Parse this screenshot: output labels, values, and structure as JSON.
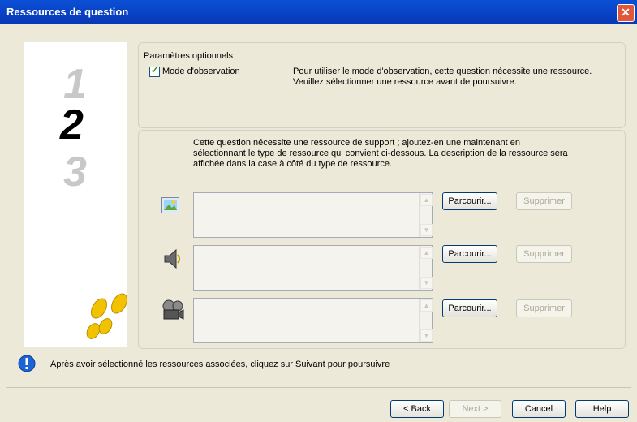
{
  "window": {
    "title": "Ressources de question",
    "close_glyph": "✕"
  },
  "steps": {
    "one": "1",
    "two": "2",
    "three": "3"
  },
  "optional": {
    "legend": "Paramètres optionnels",
    "observation_label": "Mode d'observation",
    "observation_checked": true,
    "observation_text": "Pour utiliser le mode d'observation, cette question nécessite une ressource. Veuillez sélectionner une ressource avant de poursuivre."
  },
  "resources": {
    "instructions": "Cette question nécessite une ressource de support ; ajoutez-en une maintenant en sélectionnant le type de ressource qui convient ci-dessous. La description de la ressource sera affichée dans la case à côté du type de ressource.",
    "rows": [
      {
        "type_icon": "image-icon",
        "description": "",
        "browse_label": "Parcourir...",
        "delete_label": "Supprimer"
      },
      {
        "type_icon": "speaker-icon",
        "description": "",
        "browse_label": "Parcourir...",
        "delete_label": "Supprimer"
      },
      {
        "type_icon": "film-reel-icon",
        "description": "",
        "browse_label": "Parcourir...",
        "delete_label": "Supprimer"
      }
    ]
  },
  "status": {
    "icon": "info-icon",
    "text": "Après avoir sélectionné les ressources associées, cliquez sur Suivant pour poursuivre"
  },
  "buttons": {
    "back": "< Back",
    "next": "Next >",
    "cancel": "Cancel",
    "help": "Help"
  },
  "colors": {
    "title_bar": "#0a4fd6",
    "dialog_bg": "#ece9d8",
    "footprints": "#f2c200"
  }
}
